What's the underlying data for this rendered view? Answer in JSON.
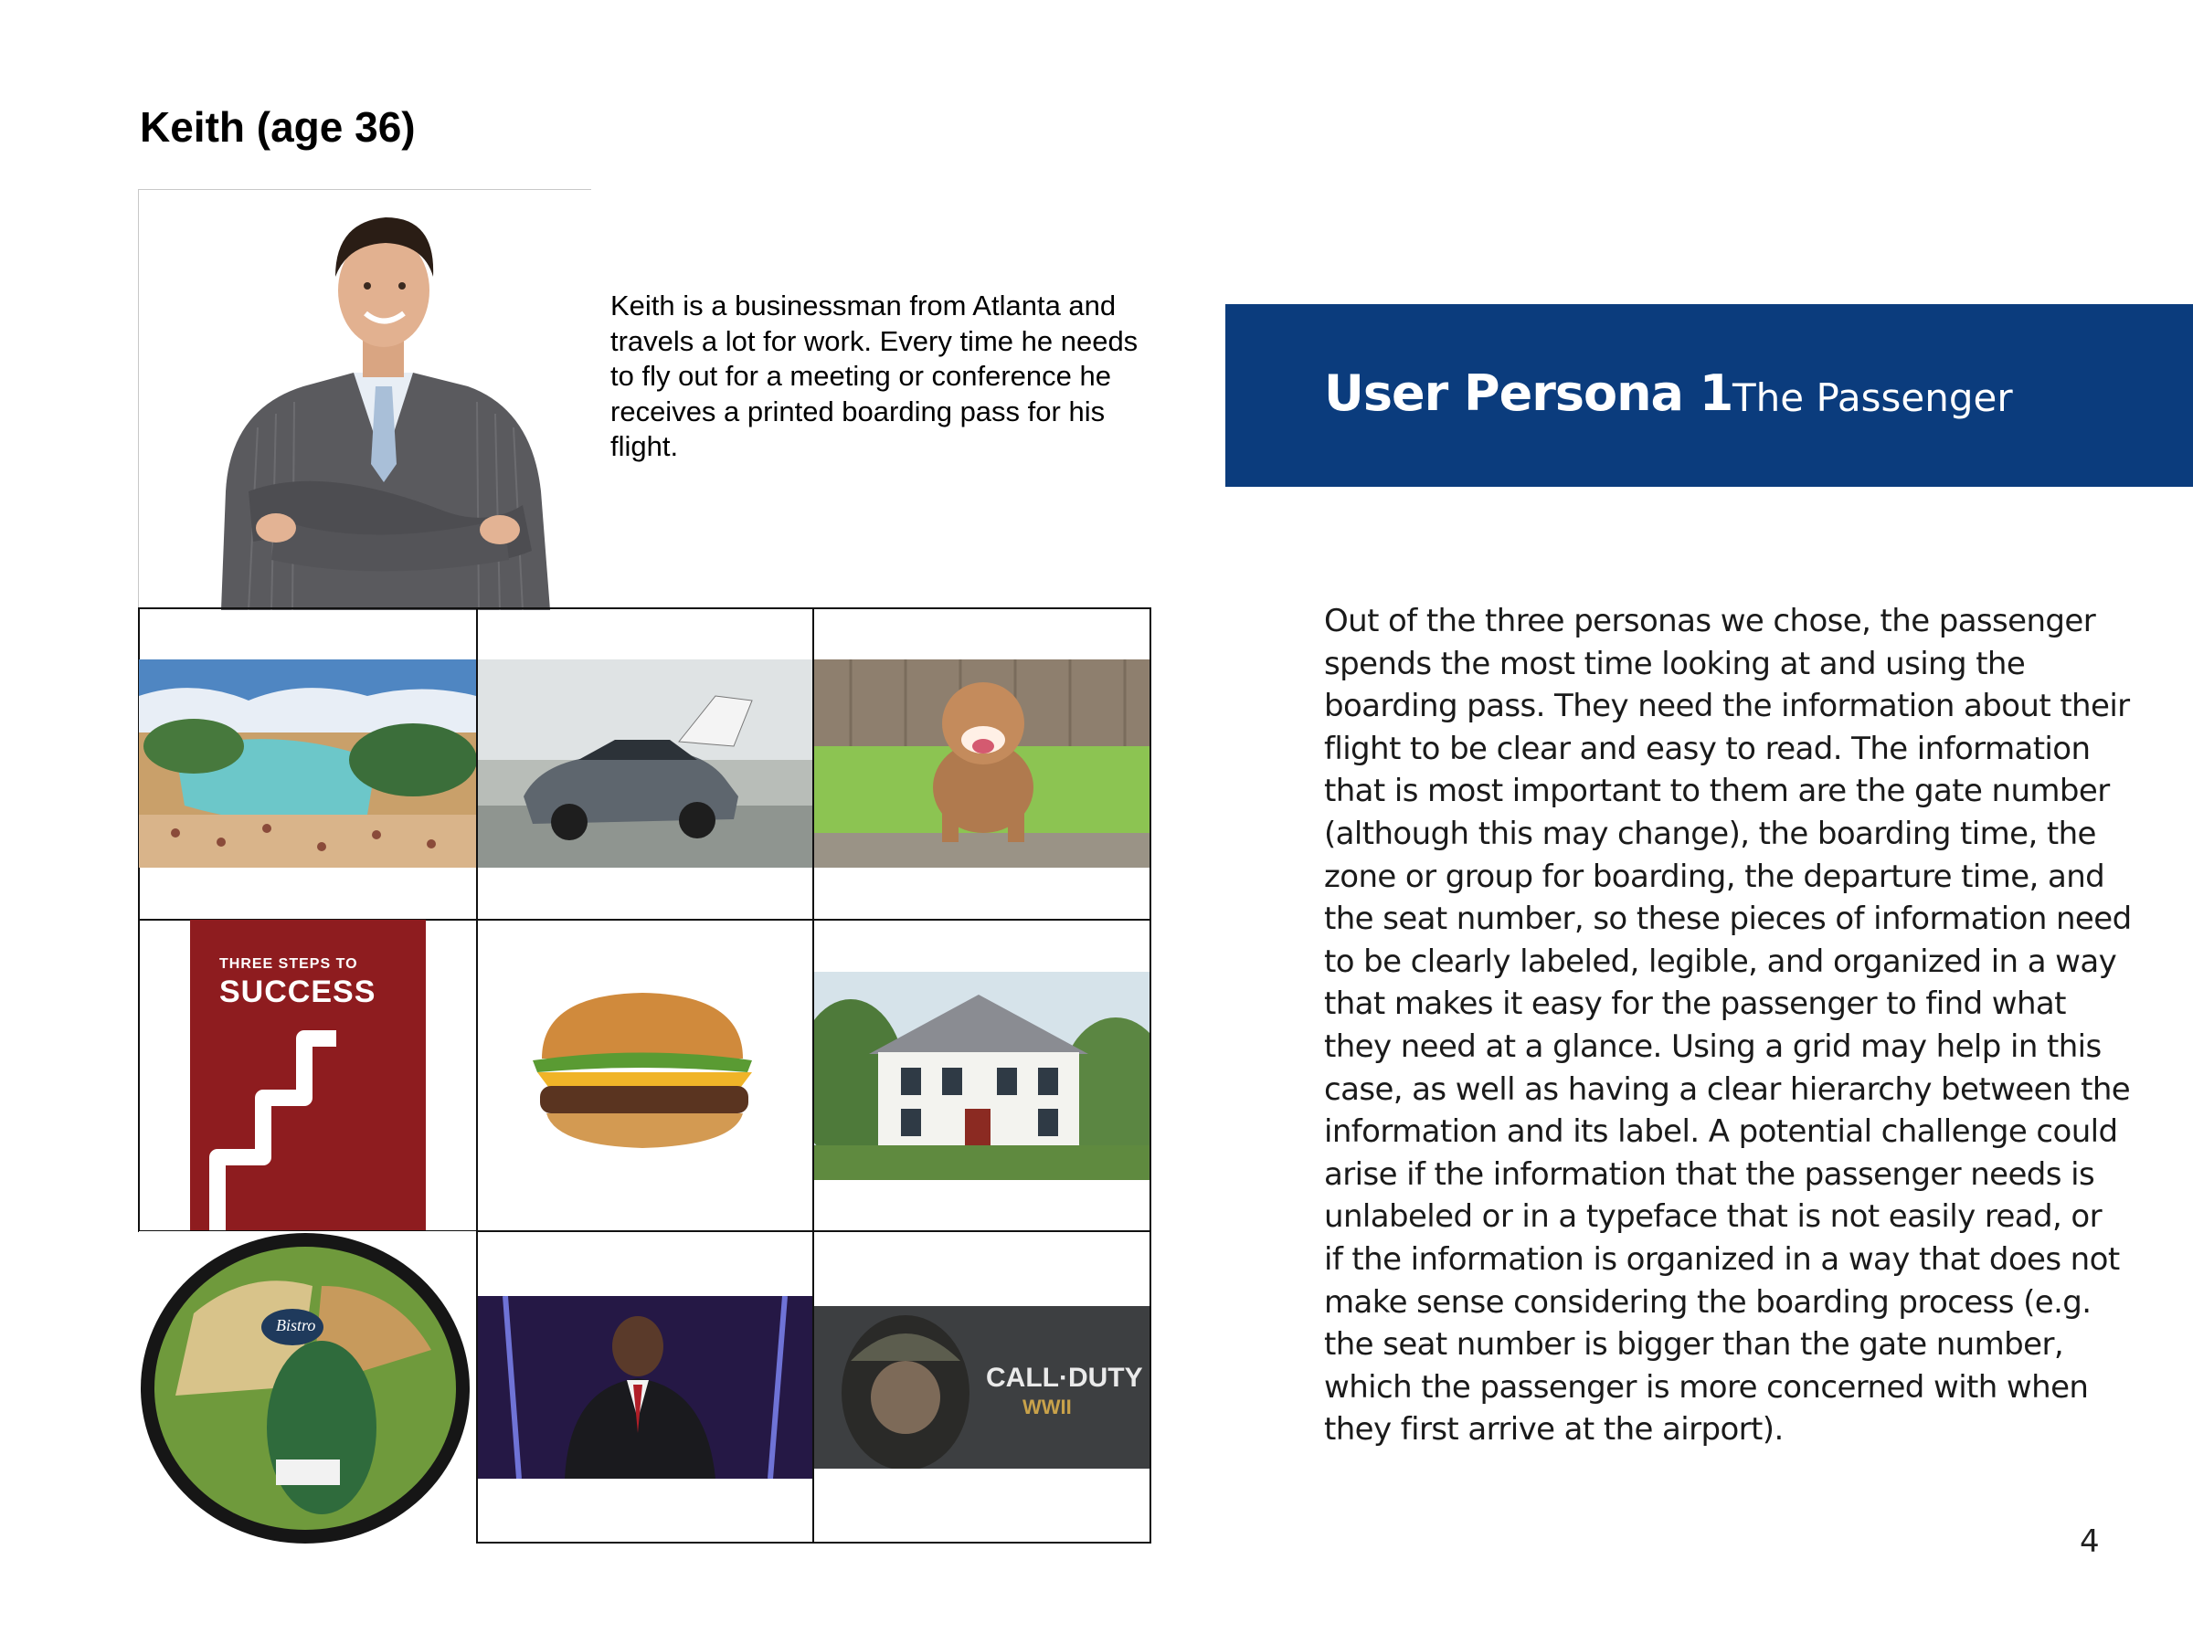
{
  "persona": {
    "name": "Keith (age 36)",
    "bio": "Keith is a businessman from Atlanta and travels a lot for work. Every time he needs to fly out for a meeting or conference he receives a printed boarding pass for his flight."
  },
  "banner": {
    "title": "User Persona 1",
    "subtitle": "The Passenger",
    "color": "#0b3c7d"
  },
  "body_lines": [
    "Out of the three personas we chose, the passenger",
    "spends the most time looking at and using the",
    "boarding pass. They need the information about their",
    "flight to be clear and easy to read. The information",
    "that is most important to them are the gate number",
    "(although this may change), the boarding time, the",
    "zone or group for boarding, the departure time, and",
    "the seat number, so these pieces of information need",
    "to be clearly labeled, legible, and organized in a way",
    "that makes it easy for the passenger to find what",
    "they need at a glance. Using a grid may help in this",
    "case, as well as having a clear hierarchy between the",
    "information and its label. A potential challenge could",
    "arise if the information that the passenger needs is",
    "unlabeled or in a typeface that is not easily read, or",
    "if the information is organized in a way that does not",
    "make sense considering the boarding process (e.g.",
    "the seat number is bigger than the gate number,",
    "which the passenger is more concerned with when",
    "they first arrive at the airport)."
  ],
  "mood_board": {
    "book": {
      "line1": "THREE STEPS TO",
      "line2": "SUCCESS"
    },
    "game_logo": "CALL·DUTY",
    "game_sub": "WWII",
    "salad_brand": "Bistro",
    "items": [
      "portrait-photo",
      "beach-resort-photo",
      "sedan-car-photo",
      "pitbull-dog-photo",
      "success-book-cover",
      "cheeseburger-photo",
      "white-house-photo",
      "salad-bowl-photo",
      "motivational-speaker-photo",
      "video-game-cover"
    ]
  },
  "page_number": "4"
}
